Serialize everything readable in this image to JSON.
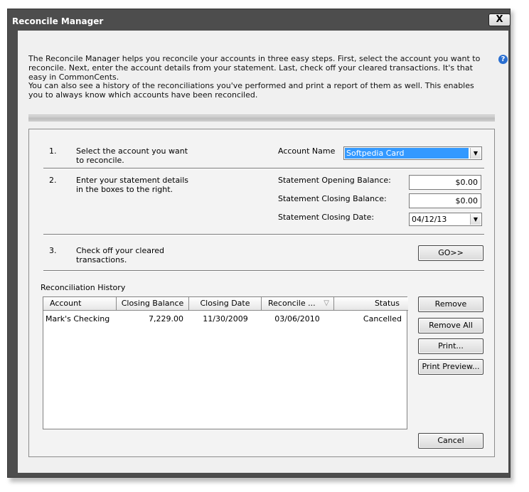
{
  "window": {
    "title": "Reconcile Manager",
    "close_label": "X"
  },
  "intro": {
    "paragraph1": "The Reconcile Manager helps you reconcile your accounts in three easy steps. First, select the account you want to reconcile. Next, enter the account details from your statement. Last, check off your cleared transactions. It's that easy in CommonCents.",
    "paragraph2": "You can also see a history of the reconciliations you've performed and print a report of them as well. This enables you to always know which accounts have been reconciled.",
    "help_icon": "?"
  },
  "steps": {
    "step1": {
      "number": "1.",
      "text": "Select the account you want to reconcile.",
      "account_label": "Account Name",
      "account_value": "Softpedia Card"
    },
    "step2": {
      "number": "2.",
      "text": "Enter your statement details in the boxes to the right.",
      "opening_label": "Statement Opening Balance:",
      "opening_value": "$0.00",
      "closing_label": "Statement Closing Balance:",
      "closing_value": "$0.00",
      "date_label": "Statement Closing Date:",
      "date_value": "04/12/13"
    },
    "step3": {
      "number": "3.",
      "text": "Check off your cleared transactions.",
      "go_label": "GO>>"
    }
  },
  "history": {
    "label": "Reconciliation History",
    "columns": [
      "Account",
      "Closing Balance",
      "Closing Date",
      "Reconcile ...",
      "Status"
    ],
    "rows": [
      {
        "account": "Mark's Checking",
        "closing_balance": "7,229.00",
        "closing_date": "11/30/2009",
        "reconcile_date": "03/06/2010",
        "status": "Cancelled"
      }
    ]
  },
  "buttons": {
    "remove": "Remove",
    "remove_all": "Remove All",
    "print": "Print...",
    "print_preview": "Print Preview...",
    "cancel": "Cancel"
  },
  "icons": {
    "dropdown": "chevron-down-icon",
    "sort": "sort-desc-icon"
  }
}
